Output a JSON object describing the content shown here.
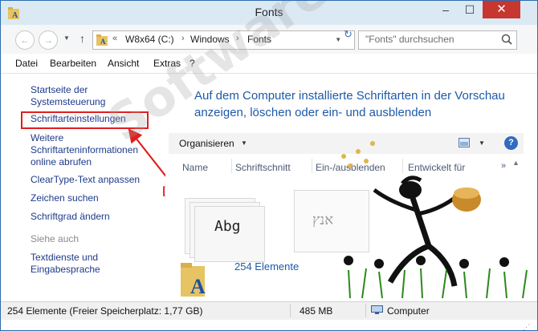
{
  "window": {
    "title": "Fonts",
    "controls": {
      "minimize": "–",
      "maximize": "☐",
      "close": "✕"
    }
  },
  "navigation": {
    "back_icon": "back-arrow-icon",
    "forward_icon": "forward-arrow-icon",
    "up_icon": "up-arrow-icon",
    "address": {
      "prefix": "«",
      "crumbs": [
        "W8x64 (C:)",
        "Windows",
        "Fonts"
      ],
      "separator": "›"
    },
    "search_placeholder": "\"Fonts\" durchsuchen"
  },
  "menu": [
    "Datei",
    "Bearbeiten",
    "Ansicht",
    "Extras",
    "?"
  ],
  "left_pane": {
    "links": [
      "Startseite der Systemsteuerung",
      "Schriftarteinstellungen",
      "Weitere Schriftarteninformationen online abrufen",
      "ClearType-Text anpassen",
      "Zeichen suchen",
      "Schriftgrad ändern"
    ],
    "see_also_header": "Siehe auch",
    "see_also_links": [
      "Textdienste und Eingabesprache"
    ],
    "highlight_color": "#e01e1e",
    "annotation": "[1]"
  },
  "main": {
    "heading": "Auf dem Computer installierte Schriftarten in der Vorschau anzeigen, löschen oder ein- und ausblenden",
    "toolbar": {
      "organize": "Organisieren"
    },
    "columns": [
      "Name",
      "Schriftschnitt",
      "Ein-/ausblenden",
      "Entwickelt für"
    ],
    "tiles": [
      {
        "sample": "Abg"
      },
      {
        "sample": "אנץ"
      }
    ],
    "item_count": "254 Elemente"
  },
  "watermark": "SoftwareOK.de",
  "status_bar": {
    "items_free": "254 Elemente (Freier Speicherplatz: 1,77 GB)",
    "size": "485 MB",
    "location": "Computer"
  },
  "colors": {
    "accent": "#1d5aa8",
    "titlebar": "#dbe9f5",
    "close": "#c7372f",
    "annotation": "#e01e1e"
  }
}
